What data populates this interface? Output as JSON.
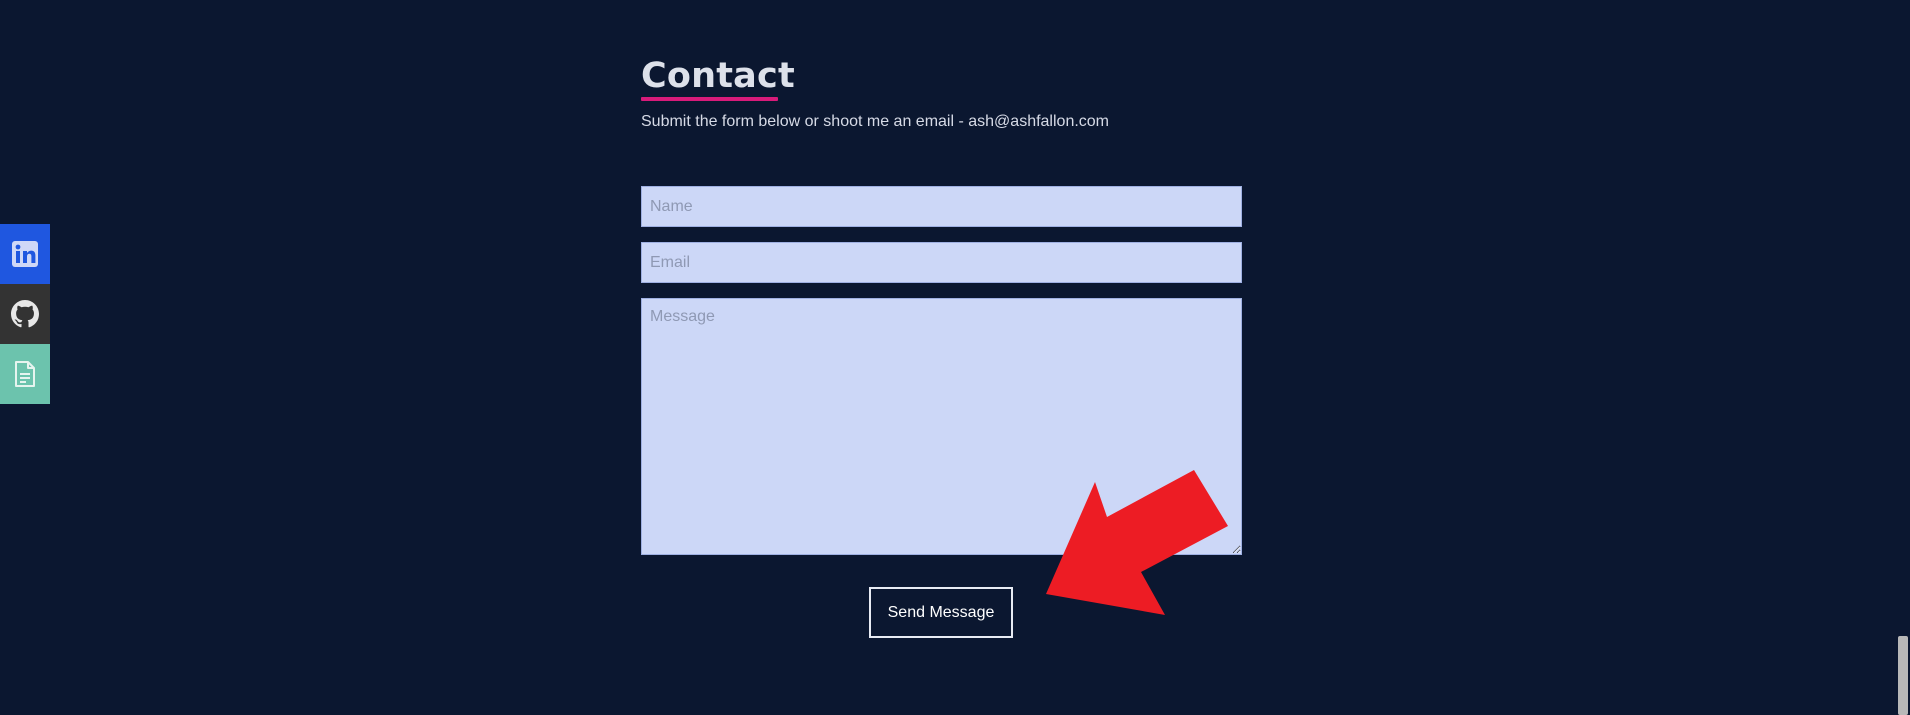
{
  "contact": {
    "title": "Contact",
    "subtitle": "Submit the form below or shoot me an email - ash@ashfallon.com"
  },
  "form": {
    "name_placeholder": "Name",
    "email_placeholder": "Email",
    "message_placeholder": "Message",
    "send_label": "Send Message"
  },
  "social": {
    "linkedin_icon": "linkedin-icon",
    "github_icon": "github-icon",
    "resume_icon": "document-icon"
  },
  "colors": {
    "background": "#0b1730",
    "accent_underline": "#d81b7a",
    "input_bg": "#ccd7f7",
    "linkedin": "#1f57e0",
    "github": "#333333",
    "resume": "#6cc3ad",
    "annotation_arrow": "#ed1c24"
  }
}
